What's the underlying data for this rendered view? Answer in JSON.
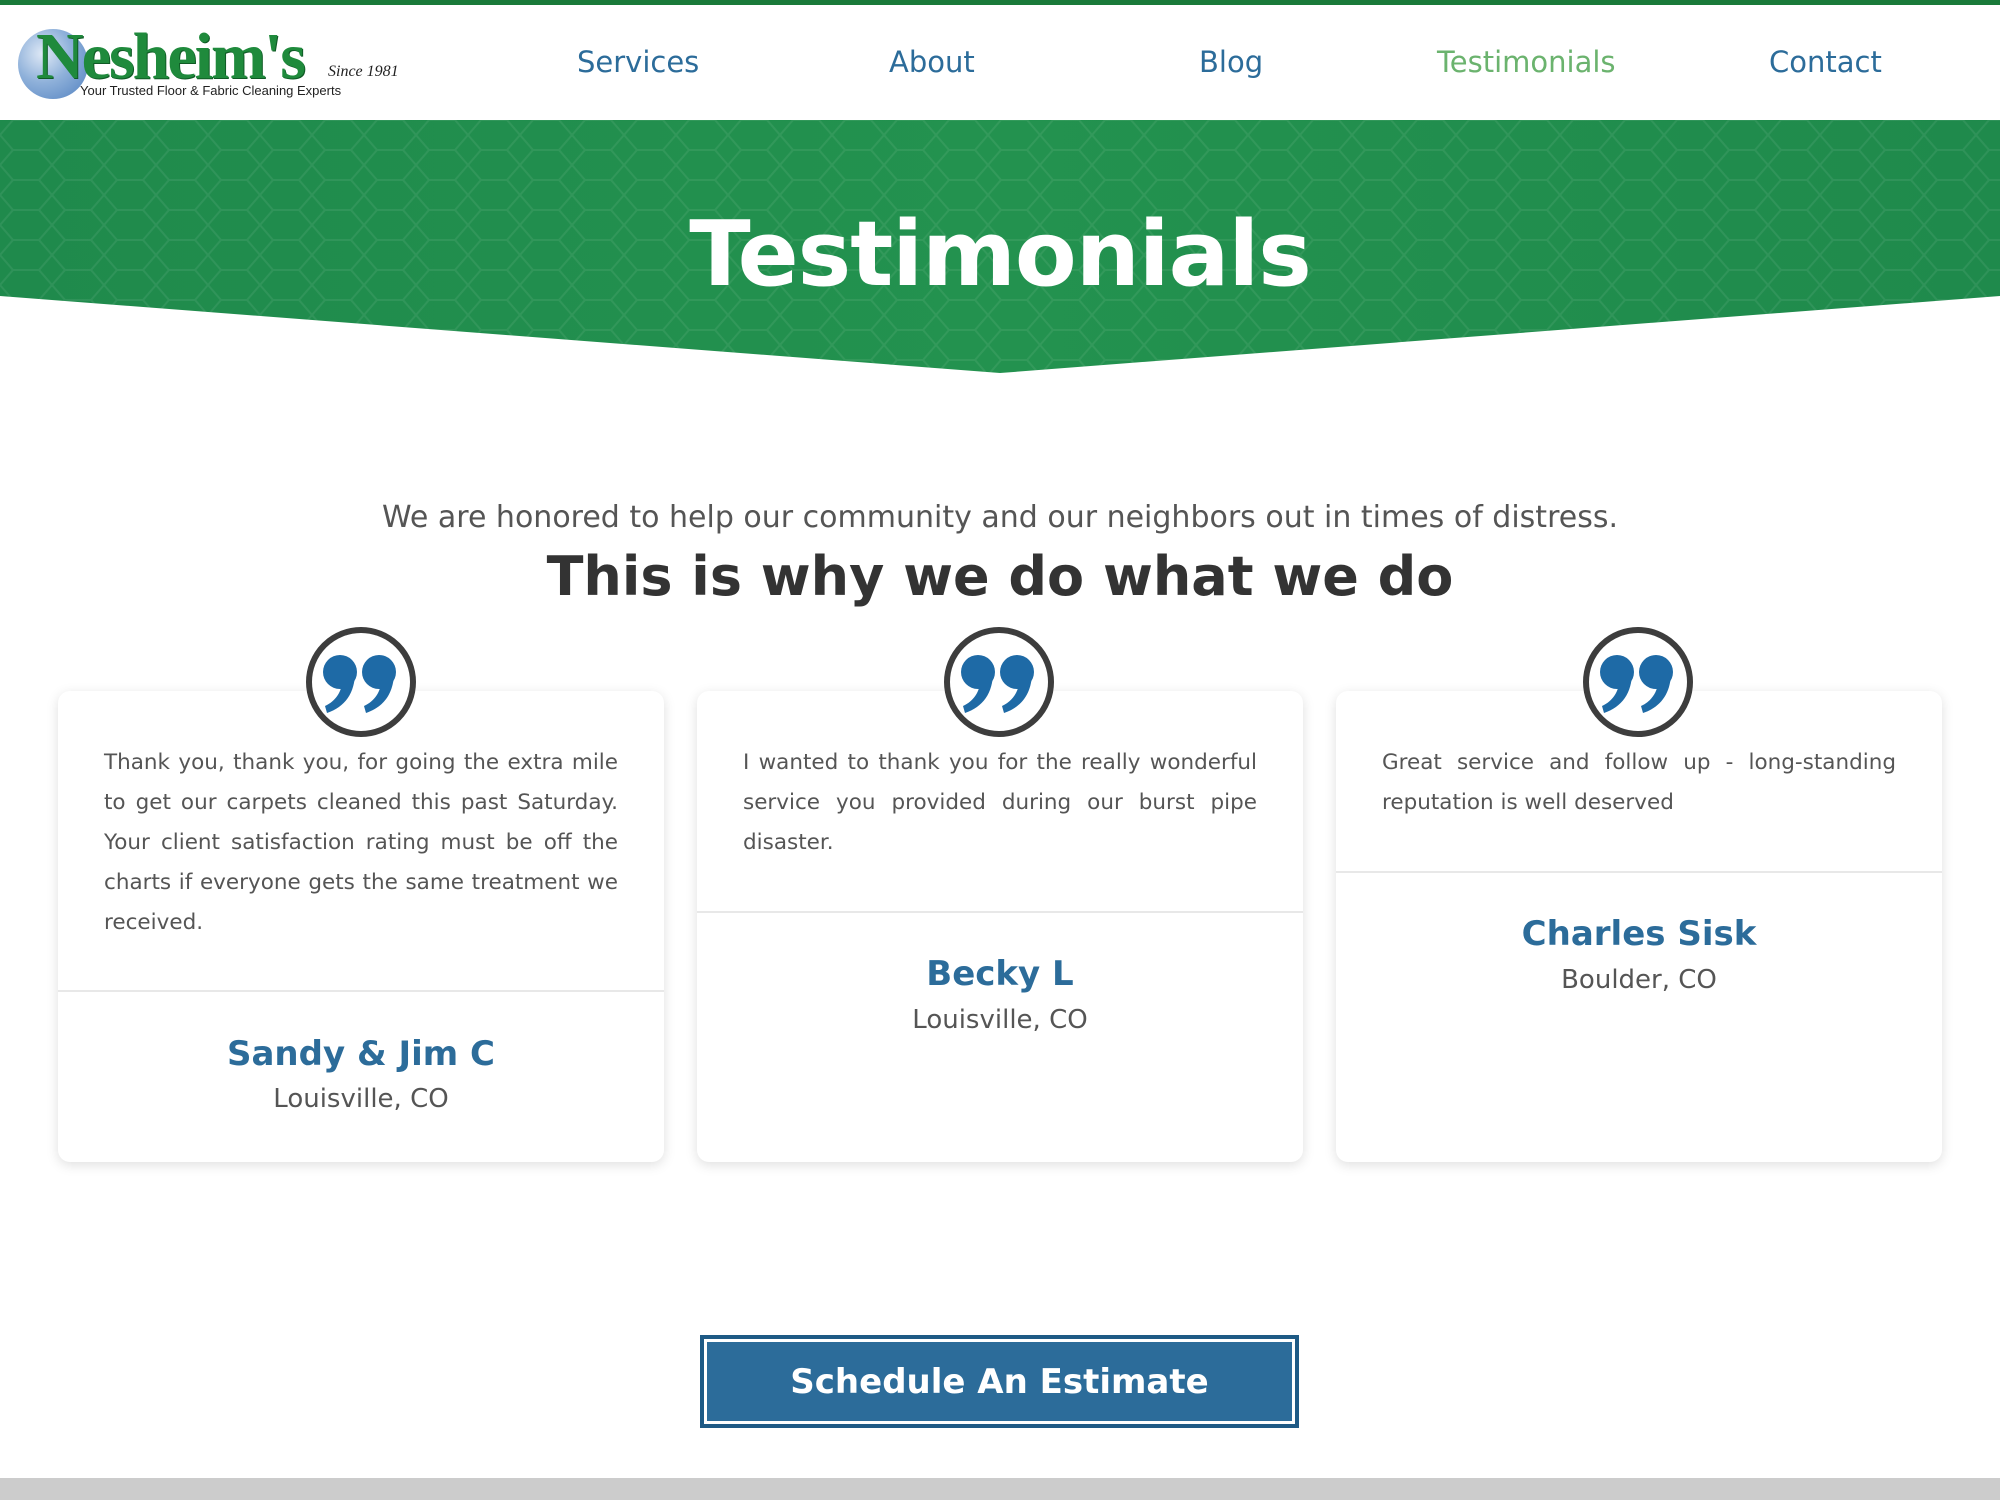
{
  "colors": {
    "brand_green": "#1f8a3c",
    "nav_blue": "#2c6c9a",
    "nav_active": "#6bb36e",
    "hero_green": "#1f8a4c",
    "button_blue": "#2c6c9a",
    "name_blue": "#2c6c9a"
  },
  "logo": {
    "wordmark": "Nesheim's",
    "since": "Since 1981",
    "tagline": "Your Trusted Floor & Fabric Cleaning Experts"
  },
  "nav": {
    "items": [
      {
        "label": "Services",
        "active": false
      },
      {
        "label": "About",
        "active": false
      },
      {
        "label": "Blog",
        "active": false
      },
      {
        "label": "Testimonials",
        "active": true
      },
      {
        "label": "Contact",
        "active": false
      }
    ]
  },
  "hero": {
    "title": "Testimonials"
  },
  "intro": {
    "text": "We are honored to help our community and our neighbors out in times of distress.",
    "headline": "This is why we do what we do"
  },
  "testimonials": [
    {
      "icon": "quote-icon",
      "text": "Thank you, thank you, for going the extra mile to get our carpets cleaned this past Saturday. Your client satisfaction rating must be off the charts if everyone gets the same treatment we received.",
      "name": "Sandy & Jim C",
      "location": "Louisville, CO"
    },
    {
      "icon": "quote-icon",
      "text": "I wanted to thank you for the really wonderful service you provided during our burst pipe disaster.",
      "name": "Becky L",
      "location": "Louisville, CO"
    },
    {
      "icon": "quote-icon",
      "text": "Great service and follow up - long-standing reputation is well deserved",
      "name": "Charles Sisk",
      "location": "Boulder, CO"
    }
  ],
  "cta": {
    "label": "Schedule An Estimate"
  }
}
